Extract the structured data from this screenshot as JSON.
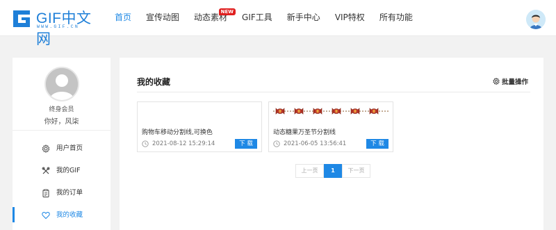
{
  "header": {
    "logo": {
      "title": "GIF中文网",
      "subtitle": "WWW.GIF.CN"
    },
    "nav": [
      {
        "label": "首页",
        "active": true
      },
      {
        "label": "宣传动图"
      },
      {
        "label": "动态素材",
        "badge": "NEW"
      },
      {
        "label": "GIF工具"
      },
      {
        "label": "新手中心"
      },
      {
        "label": "VIP特权"
      },
      {
        "label": "所有功能"
      }
    ]
  },
  "sidebar": {
    "member_type": "终身会员",
    "greeting": "你好，风柒",
    "menu": [
      {
        "label": "用户首页",
        "icon": "gear-icon"
      },
      {
        "label": "我的GIF",
        "icon": "tools-icon"
      },
      {
        "label": "我的订单",
        "icon": "clipboard-icon"
      },
      {
        "label": "我的收藏",
        "icon": "heart-icon",
        "active": true
      }
    ]
  },
  "main": {
    "title": "我的收藏",
    "batch_label": "批量操作",
    "cards": [
      {
        "title": "购物车移动分割线,可换色",
        "date": "2021-08-12 15:29:14",
        "download_label": "下 载"
      },
      {
        "title": "动态糖果万圣节分割线",
        "date": "2021-06-05 13:56:41",
        "download_label": "下 载"
      }
    ],
    "pagination": {
      "prev": "上一页",
      "current": "1",
      "next": "下一页"
    }
  },
  "colors": {
    "accent": "#1e88e5",
    "badge": "#e02020",
    "candy": "#c0392b"
  }
}
